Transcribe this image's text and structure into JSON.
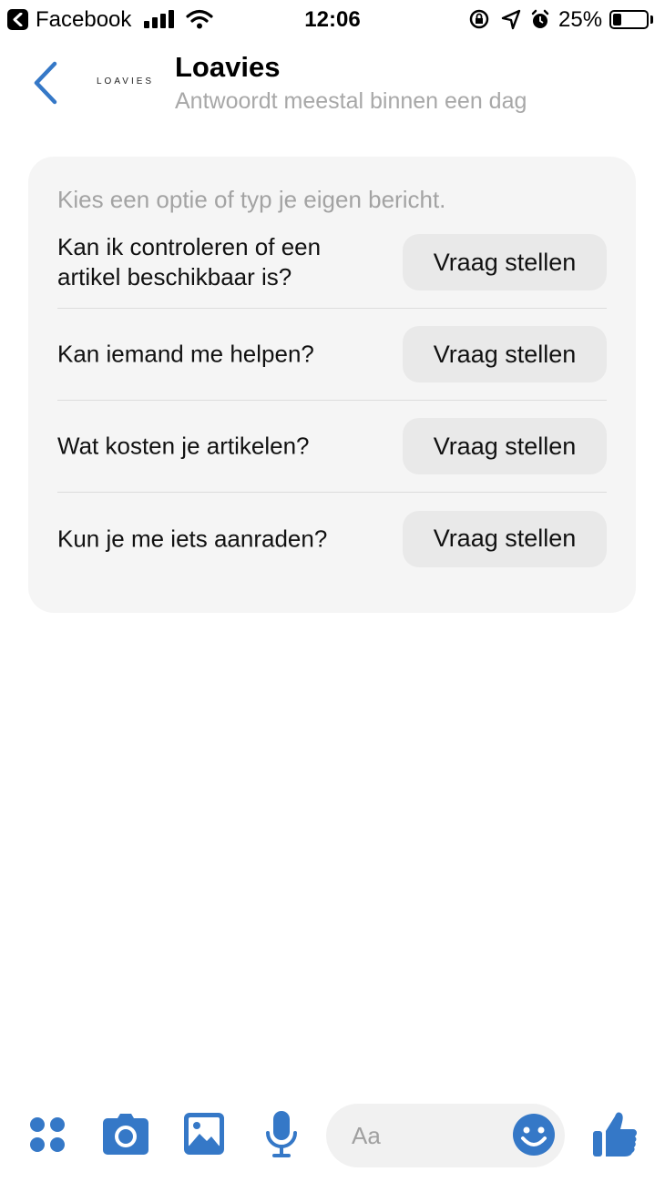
{
  "status_bar": {
    "app_name": "Facebook",
    "time": "12:06",
    "battery": "25%",
    "battery_level": 0.25
  },
  "header": {
    "logo_text": "LOAVIES",
    "title": "Loavies",
    "subtitle": "Antwoordt meestal binnen een dag"
  },
  "card": {
    "intro": "Kies een optie of typ je eigen bericht.",
    "options": [
      {
        "text": "Kan ik controleren of een artikel beschikbaar is?",
        "button": "Vraag stellen"
      },
      {
        "text": "Kan iemand me helpen?",
        "button": "Vraag stellen"
      },
      {
        "text": "Wat kosten je artikelen?",
        "button": "Vraag stellen"
      },
      {
        "text": "Kun je me iets aanraden?",
        "button": "Vraag stellen"
      }
    ]
  },
  "composer": {
    "placeholder": "Aa"
  },
  "colors": {
    "accent": "#3578c7",
    "card_bg": "#f5f5f5",
    "button_bg": "#e9e9e9",
    "muted_text": "#a8a8a8"
  }
}
